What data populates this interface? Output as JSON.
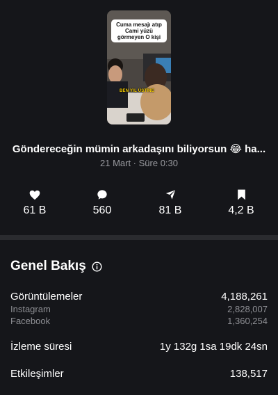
{
  "video": {
    "bubble_lines": [
      "Cuma mesajı atıp",
      "Cami yüzü",
      "görmeyen O kişi"
    ],
    "caption": "BEN YIL ÜSTİNE",
    "title": "Göndereceğin mümin arkadaşını biliyorsun 😂 ha...",
    "meta": "21 Mart · Süre 0:30"
  },
  "stats": [
    {
      "icon": "heart-icon",
      "value": "61 B"
    },
    {
      "icon": "comment-icon",
      "value": "560"
    },
    {
      "icon": "share-icon",
      "value": "81 B"
    },
    {
      "icon": "bookmark-icon",
      "value": "4,2 B"
    }
  ],
  "overview": {
    "title": "Genel Bakış",
    "info_icon": "info-icon",
    "views_label": "Görüntülemeler",
    "views_value": "4,188,261",
    "instagram_label": "Instagram",
    "instagram_value": "2,828,007",
    "facebook_label": "Facebook",
    "facebook_value": "1,360,254",
    "watch_time_label": "İzleme süresi",
    "watch_time_value": "1y 132g 1sa 19dk 24sn",
    "interactions_label": "Etkileşimler",
    "interactions_value": "138,517"
  },
  "colors": {
    "background": "#15161a",
    "muted_text": "#9a9ba0",
    "divider": "#2a2b2f"
  }
}
